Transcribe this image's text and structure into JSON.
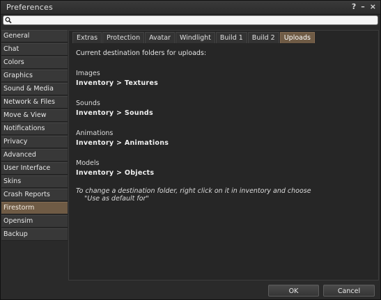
{
  "window": {
    "title": "Preferences",
    "help_label": "?",
    "minimize_label": "–",
    "close_label": "×"
  },
  "search": {
    "value": "",
    "placeholder": ""
  },
  "sidebar": {
    "items": [
      {
        "label": "General"
      },
      {
        "label": "Chat"
      },
      {
        "label": "Colors"
      },
      {
        "label": "Graphics"
      },
      {
        "label": "Sound & Media"
      },
      {
        "label": "Network & Files"
      },
      {
        "label": "Move & View"
      },
      {
        "label": "Notifications"
      },
      {
        "label": "Privacy"
      },
      {
        "label": "Advanced"
      },
      {
        "label": "User Interface"
      },
      {
        "label": "Skins"
      },
      {
        "label": "Crash Reports"
      },
      {
        "label": "Firestorm"
      },
      {
        "label": "Opensim"
      },
      {
        "label": "Backup"
      }
    ],
    "selected": "Firestorm"
  },
  "tabs": {
    "items": [
      {
        "label": "Extras"
      },
      {
        "label": "Protection"
      },
      {
        "label": "Avatar"
      },
      {
        "label": "Windlight"
      },
      {
        "label": "Build 1"
      },
      {
        "label": "Build 2"
      },
      {
        "label": "Uploads"
      }
    ],
    "selected": "Uploads"
  },
  "uploads": {
    "intro": "Current destination folders for uploads:",
    "groups": [
      {
        "label": "Images",
        "value": "Inventory > Textures"
      },
      {
        "label": "Sounds",
        "value": "Inventory > Sounds"
      },
      {
        "label": "Animations",
        "value": "Inventory > Animations"
      },
      {
        "label": "Models",
        "value": "Inventory > Objects"
      }
    ],
    "hint_line1": "To change a destination folder, right click on it in inventory and choose",
    "hint_line2": "\"Use as default for\""
  },
  "buttons": {
    "ok": "OK",
    "cancel": "Cancel"
  },
  "colors": {
    "accent": "#6f5b45",
    "background": "#2a2a2a",
    "panel": "#262626"
  }
}
